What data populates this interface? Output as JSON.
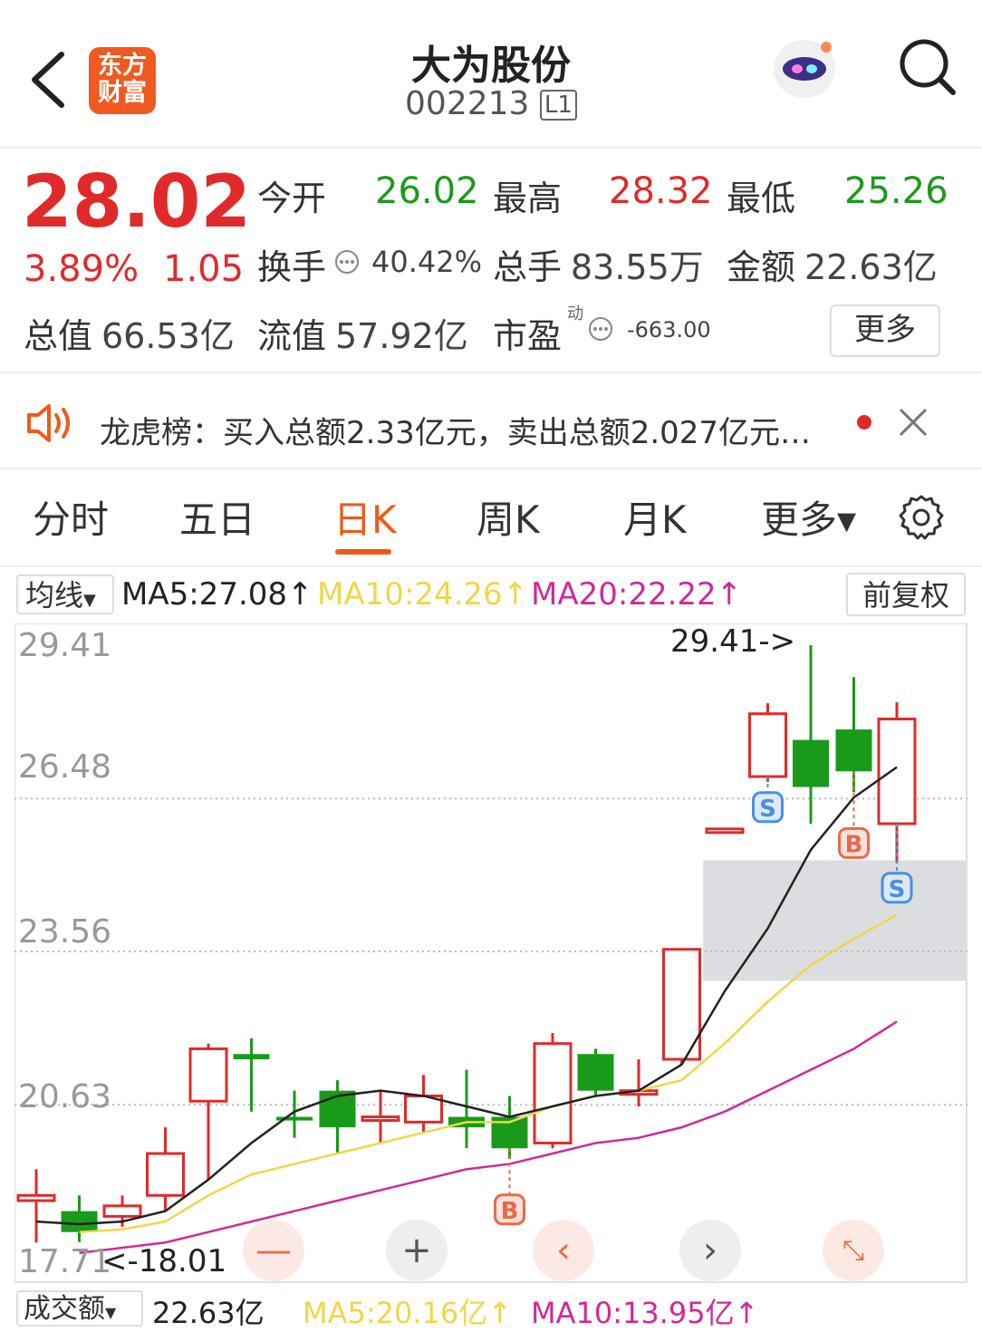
{
  "header": {
    "title": "大为股份",
    "code": "002213",
    "level_badge": "L1",
    "logo_text_line1": "东方",
    "logo_text_line2": "财富"
  },
  "quote": {
    "price": "28.02",
    "change_pct": "3.89%",
    "change": "1.05",
    "open_label": "今开",
    "open": "26.02",
    "high_label": "最高",
    "high": "28.32",
    "low_label": "最低",
    "low": "25.26",
    "turnover_label": "换手",
    "turnover": "40.42%",
    "volume_label": "总手",
    "volume": "83.55万",
    "amount_label": "金额",
    "amount": "22.63亿",
    "mcap_label": "总值",
    "mcap": "66.53亿",
    "float_label": "流值",
    "float": "57.92亿",
    "pe_label": "市盈",
    "pe_sup": "动",
    "pe": "-663.00",
    "more_button": "更多"
  },
  "notice": {
    "text": "龙虎榜：买入总额2.33亿元，卖出总额2.027亿元…"
  },
  "tabs": [
    "分时",
    "五日",
    "日K",
    "周K",
    "月K",
    "更多▾"
  ],
  "active_tab": "日K",
  "ma_bar": {
    "selector": "均线",
    "ma5": "MA5:27.08↑",
    "ma10": "MA10:24.26↑",
    "ma20": "MA20:22.22↑",
    "adjust_button": "前复权"
  },
  "chart_labels": {
    "y_ticks": [
      "29.41",
      "26.48",
      "23.56",
      "20.63",
      "17.71"
    ],
    "max_annotation": "29.41->",
    "min_annotation": "<-18.01",
    "signal_s": "S",
    "signal_b": "B"
  },
  "bottom_bar": {
    "selector": "成交额",
    "value": "22.63亿",
    "ma5": "MA5:20.16亿↑",
    "ma10": "MA10:13.95亿↑"
  },
  "colors": {
    "up": "#e02a2a",
    "down": "#1a9a1a",
    "accent": "#ef5a18",
    "ma5": "#222222",
    "ma10": "#f2d54a",
    "ma20": "#d0299a"
  },
  "chart_data": {
    "type": "candlestick",
    "ylim": [
      17.71,
      29.41
    ],
    "y_ticks": [
      29.41,
      26.48,
      23.56,
      20.63,
      17.71
    ],
    "candles": [
      {
        "o": 18.9,
        "c": 18.8,
        "h": 19.4,
        "l": 18.0,
        "dir": "up"
      },
      {
        "o": 18.6,
        "c": 18.2,
        "h": 18.9,
        "l": 18.01,
        "dir": "down"
      },
      {
        "o": 18.5,
        "c": 18.7,
        "h": 18.9,
        "l": 18.3,
        "dir": "up"
      },
      {
        "o": 18.9,
        "c": 19.7,
        "h": 20.2,
        "l": 18.6,
        "dir": "up"
      },
      {
        "o": 20.7,
        "c": 21.7,
        "h": 21.8,
        "l": 19.2,
        "dir": "up"
      },
      {
        "o": 21.6,
        "c": 21.5,
        "h": 21.9,
        "l": 20.5,
        "dir": "down"
      },
      {
        "o": 20.4,
        "c": 20.4,
        "h": 20.9,
        "l": 20.0,
        "dir": "down"
      },
      {
        "o": 20.9,
        "c": 20.2,
        "h": 21.1,
        "l": 19.7,
        "dir": "down"
      },
      {
        "o": 20.4,
        "c": 20.4,
        "h": 20.9,
        "l": 19.9,
        "dir": "up"
      },
      {
        "o": 20.3,
        "c": 20.8,
        "h": 21.2,
        "l": 20.1,
        "dir": "up"
      },
      {
        "o": 20.4,
        "c": 20.2,
        "h": 21.3,
        "l": 19.8,
        "dir": "down"
      },
      {
        "o": 20.4,
        "c": 19.8,
        "h": 20.8,
        "l": 19.6,
        "dir": "down"
      },
      {
        "o": 19.9,
        "c": 21.8,
        "h": 22.0,
        "l": 19.8,
        "dir": "up"
      },
      {
        "o": 21.6,
        "c": 20.9,
        "h": 21.7,
        "l": 20.8,
        "dir": "down"
      },
      {
        "o": 20.9,
        "c": 20.9,
        "h": 21.5,
        "l": 20.6,
        "dir": "up"
      },
      {
        "o": 21.5,
        "c": 23.6,
        "h": 23.6,
        "l": 21.4,
        "dir": "up"
      },
      {
        "o": 25.9,
        "c": 25.9,
        "h": 25.9,
        "l": 25.9,
        "dir": "up"
      },
      {
        "o": 26.9,
        "c": 28.1,
        "h": 28.3,
        "l": 26.8,
        "dir": "up"
      },
      {
        "o": 27.6,
        "c": 26.7,
        "h": 29.41,
        "l": 26.0,
        "dir": "down"
      },
      {
        "o": 27.8,
        "c": 27.0,
        "h": 28.8,
        "l": 26.6,
        "dir": "down"
      },
      {
        "o": 26.0,
        "c": 28.0,
        "h": 28.32,
        "l": 25.26,
        "dir": "up"
      }
    ],
    "ma5": [
      18.4,
      18.35,
      18.4,
      18.6,
      19.2,
      19.9,
      20.5,
      20.8,
      20.9,
      20.8,
      20.6,
      20.4,
      20.6,
      20.8,
      20.9,
      21.4,
      22.8,
      24.0,
      25.5,
      26.5,
      27.08
    ],
    "ma10": [
      null,
      18.2,
      18.25,
      18.4,
      18.9,
      19.3,
      19.5,
      19.7,
      19.9,
      20.1,
      20.3,
      20.3,
      20.6,
      20.8,
      20.9,
      21.1,
      21.8,
      22.6,
      23.3,
      23.8,
      24.26
    ],
    "ma20": [
      null,
      17.8,
      17.9,
      18.0,
      18.2,
      18.4,
      18.6,
      18.8,
      19.0,
      19.2,
      19.4,
      19.5,
      19.7,
      19.9,
      20.0,
      20.2,
      20.5,
      20.9,
      21.3,
      21.7,
      22.22
    ],
    "signals": [
      {
        "index": 11,
        "type": "B"
      },
      {
        "index": 17,
        "type": "S"
      },
      {
        "index": 19,
        "type": "B"
      },
      {
        "index": 20,
        "type": "S"
      }
    ]
  }
}
